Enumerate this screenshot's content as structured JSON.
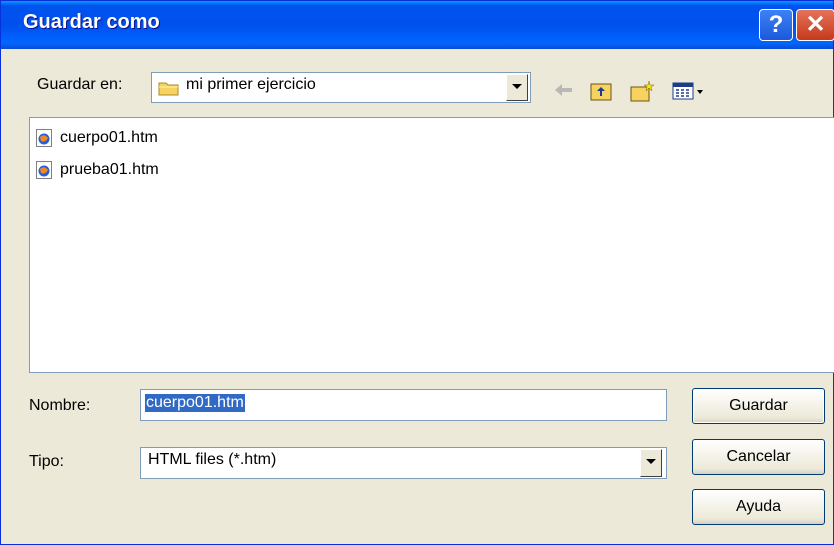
{
  "dialog": {
    "title": "Guardar como",
    "help_glyph": "?",
    "close_glyph": "✕"
  },
  "location": {
    "label": "Guardar en:",
    "current_folder": "mi primer ejercicio",
    "folder_icon": "folder-icon"
  },
  "toolbar": {
    "back_icon": "back-arrow-icon",
    "up_icon": "up-folder-icon",
    "new_folder_icon": "new-folder-icon",
    "view_menu_icon": "view-menu-icon"
  },
  "files": [
    {
      "name": "cuerpo01.htm",
      "icon": "html-file-icon"
    },
    {
      "name": "prueba01.htm",
      "icon": "html-file-icon"
    }
  ],
  "filename": {
    "label": "Nombre:",
    "value": "cuerpo01.htm"
  },
  "filetype": {
    "label": "Tipo:",
    "value": "HTML files (*.htm)"
  },
  "buttons": {
    "save": "Guardar",
    "cancel": "Cancelar",
    "help": "Ayuda"
  },
  "colors": {
    "titlebar": "#0054e3",
    "selection": "#316ac5",
    "dialog_bg": "#ece9d8"
  }
}
